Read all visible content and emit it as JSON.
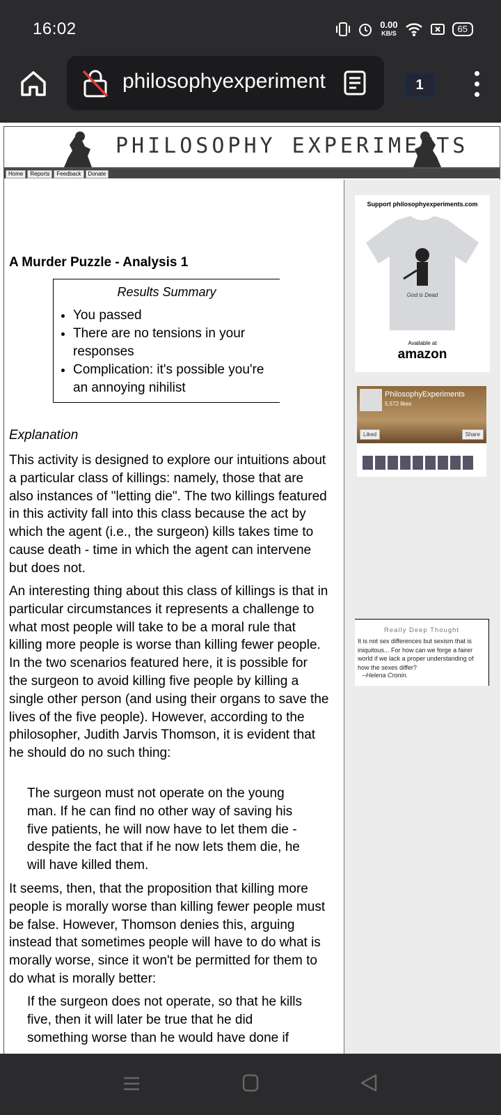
{
  "status_bar": {
    "time": "16:02",
    "net_speed_value": "0.00",
    "net_speed_unit": "KB/S",
    "battery": "65"
  },
  "browser": {
    "url": "philosophyexperiment",
    "tab_count": "1"
  },
  "site": {
    "title": "PHILOSOPHY EXPERIMENTS",
    "nav": [
      "Home",
      "Reports",
      "Feedback",
      "Donate"
    ]
  },
  "article": {
    "title": "A Murder Puzzle - Analysis 1",
    "results_heading": "Results Summary",
    "results": [
      "You passed",
      "There are no tensions in your responses",
      "Complication: it's possible you're an annoying nihilist"
    ],
    "explanation_heading": "Explanation",
    "paragraph1": "This activity is designed to explore our intuitions about a particular class of killings: namely, those that are also instances of \"letting die\". The two killings featured in this activity fall into this class because the act by which the agent (i.e., the surgeon) kills takes time to cause death - time in which the agent can intervene but does not.",
    "paragraph2": "An interesting thing about this class of killings is that in particular circumstances it represents a challenge to what most people will take to be a moral rule that killing more people is worse than killing fewer people. In the two scenarios featured here, it is possible for the surgeon to avoid killing five people by killing a single other person (and using their organs to save the lives of the five people). However, according to the philosopher, Judith Jarvis Thomson, it is evident that he should do no such thing:",
    "quote1": "The surgeon must not operate on the young man. If he can find no other way of saving his five patients, he will now have to let them die - despite the fact that if he now lets them die, he will have killed them.",
    "paragraph3": "It seems, then, that the proposition that killing more people is morally worse than killing fewer people must be false. However, Thomson denies this, arguing instead that sometimes people will have to do what is morally worse, since it won't be permitted for them to do what is morally better:",
    "quote2": "If the surgeon does not operate, so that he kills five, then it will later be true that he did something worse than he would have done if"
  },
  "sidebar": {
    "ad_title": "Support philosophyexperiments.com",
    "shirt_caption": "God is Dead",
    "ad_available": "Available at",
    "ad_brand": "amazon",
    "fb_name": "PhilosophyExperiments",
    "fb_likes": "5,572 likes",
    "fb_liked": "Liked",
    "fb_share": "Share",
    "thought_title": "Really Deep Thought",
    "thought_text": "It is not sex differences but sexism that is iniquitous... For how can we forge a fairer world if we lack a proper understanding of how the sexes differ?",
    "thought_author": "--Helena Cronin."
  }
}
